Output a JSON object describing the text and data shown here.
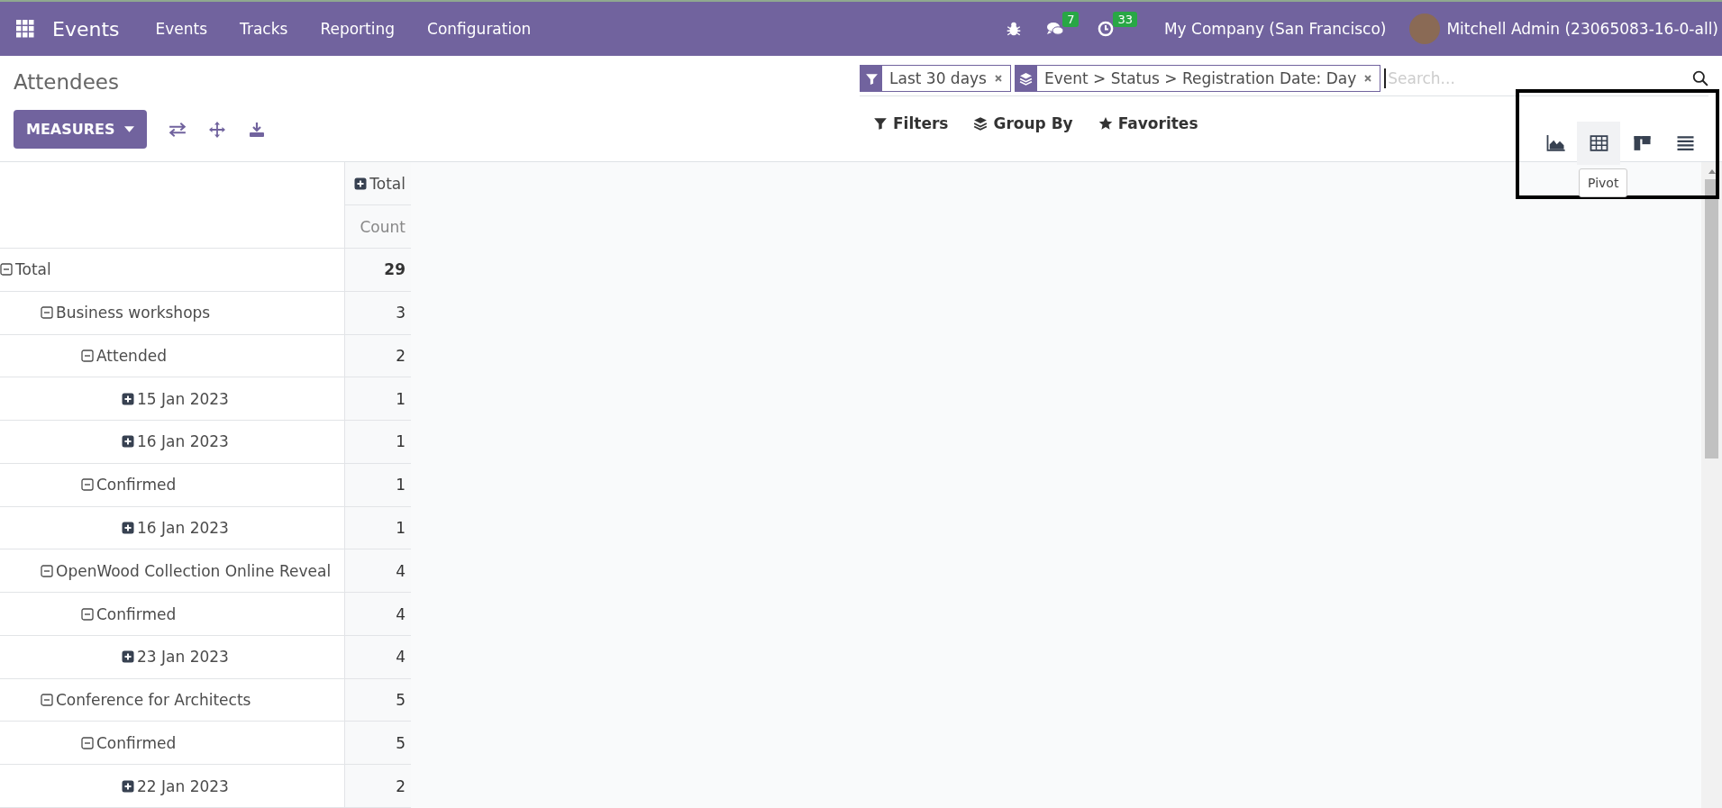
{
  "navbar": {
    "app_name": "Events",
    "menu": [
      "Events",
      "Tracks",
      "Reporting",
      "Configuration"
    ],
    "messages_badge": "7",
    "activities_badge": "33",
    "company": "My Company (San Francisco)",
    "user": "Mitchell Admin (23065083-16-0-all)"
  },
  "control_panel": {
    "title": "Attendees",
    "measures_button": "MEASURES",
    "facets": [
      {
        "kind": "filter",
        "label": "Last 30 days"
      },
      {
        "kind": "groupby",
        "label": "Event > Status > Registration Date: Day"
      }
    ],
    "search": {
      "placeholder": "Search..."
    },
    "search_menus": [
      {
        "kind": "filter",
        "label": "Filters"
      },
      {
        "kind": "groupby",
        "label": "Group By"
      },
      {
        "kind": "favorite",
        "label": "Favorites"
      }
    ],
    "views": [
      {
        "kind": "graph",
        "selected": false
      },
      {
        "kind": "pivot",
        "selected": true
      },
      {
        "kind": "kanban",
        "selected": false
      },
      {
        "kind": "list",
        "selected": false
      }
    ],
    "tooltip": "Pivot"
  },
  "pivot": {
    "column_header": {
      "label": "Total",
      "expanded": false
    },
    "measure": "Count",
    "rows": [
      {
        "label": "Total",
        "count": "29",
        "expanded": true,
        "children": [
          {
            "label": "Business workshops",
            "count": "3",
            "expanded": true,
            "children": [
              {
                "label": "Attended",
                "count": "2",
                "expanded": true,
                "children": [
                  {
                    "label": "15 Jan 2023",
                    "count": "1",
                    "expanded": false
                  },
                  {
                    "label": "16 Jan 2023",
                    "count": "1",
                    "expanded": false
                  }
                ]
              },
              {
                "label": "Confirmed",
                "count": "1",
                "expanded": true,
                "children": [
                  {
                    "label": "16 Jan 2023",
                    "count": "1",
                    "expanded": false
                  }
                ]
              }
            ]
          },
          {
            "label": "OpenWood Collection Online Reveal",
            "count": "4",
            "expanded": true,
            "children": [
              {
                "label": "Confirmed",
                "count": "4",
                "expanded": true,
                "children": [
                  {
                    "label": "23 Jan 2023",
                    "count": "4",
                    "expanded": false
                  }
                ]
              }
            ]
          },
          {
            "label": "Conference for Architects",
            "count": "5",
            "expanded": true,
            "children": [
              {
                "label": "Confirmed",
                "count": "5",
                "expanded": true,
                "children": [
                  {
                    "label": "22 Jan 2023",
                    "count": "2",
                    "expanded": false
                  }
                ]
              }
            ]
          }
        ]
      }
    ]
  }
}
